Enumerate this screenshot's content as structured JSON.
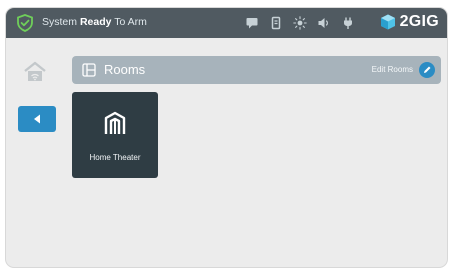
{
  "status_bar": {
    "status_prefix": "System",
    "status_bold": "Ready",
    "status_suffix": "To Arm",
    "brand": "2GIG",
    "icons": [
      "shield-check-icon",
      "message-icon",
      "bookmark-icon",
      "brightness-icon",
      "volume-icon",
      "plug-icon",
      "2gig-logo-icon"
    ]
  },
  "nav": {
    "home_icon": "home-wifi-icon",
    "back_icon": "back-arrow-icon"
  },
  "rooms_header": {
    "title": "Rooms",
    "edit_label": "Edit Rooms",
    "icon": "rooms-icon",
    "edit_icon": "pencil-icon"
  },
  "rooms": [
    {
      "name": "Home Theater",
      "icon": "home-theater-icon"
    }
  ],
  "colors": {
    "status_bar_bg": "#505a61",
    "accent_blue": "#2b8cc4",
    "rooms_bar_bg": "#a7b3bb",
    "tile_bg": "#2f3d44",
    "panel_bg": "#ececec",
    "shield_green": "#6fcf5a"
  }
}
